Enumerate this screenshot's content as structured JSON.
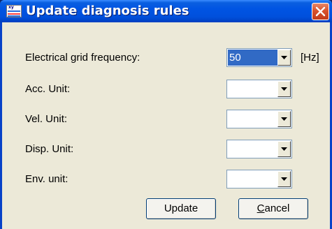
{
  "window": {
    "title": "Update diagnosis rules",
    "icon": "xy-chart-app-icon",
    "close_icon": "close-x-icon"
  },
  "fields": [
    {
      "label": "Electrical grid frequency:",
      "value": "50",
      "unit": "[Hz]"
    },
    {
      "label": "Acc. Unit:",
      "value": ""
    },
    {
      "label": "Vel. Unit:",
      "value": ""
    },
    {
      "label": "Disp. Unit:",
      "value": ""
    },
    {
      "label": "Env. unit:",
      "value": ""
    }
  ],
  "buttons": {
    "update": "Update",
    "cancel_prefix": "C",
    "cancel_rest": "ancel"
  },
  "colors": {
    "title_bar": "#0054e3",
    "dialog_bg": "#ece9d8",
    "selection": "#316ac5",
    "close_button": "#d9522c"
  }
}
